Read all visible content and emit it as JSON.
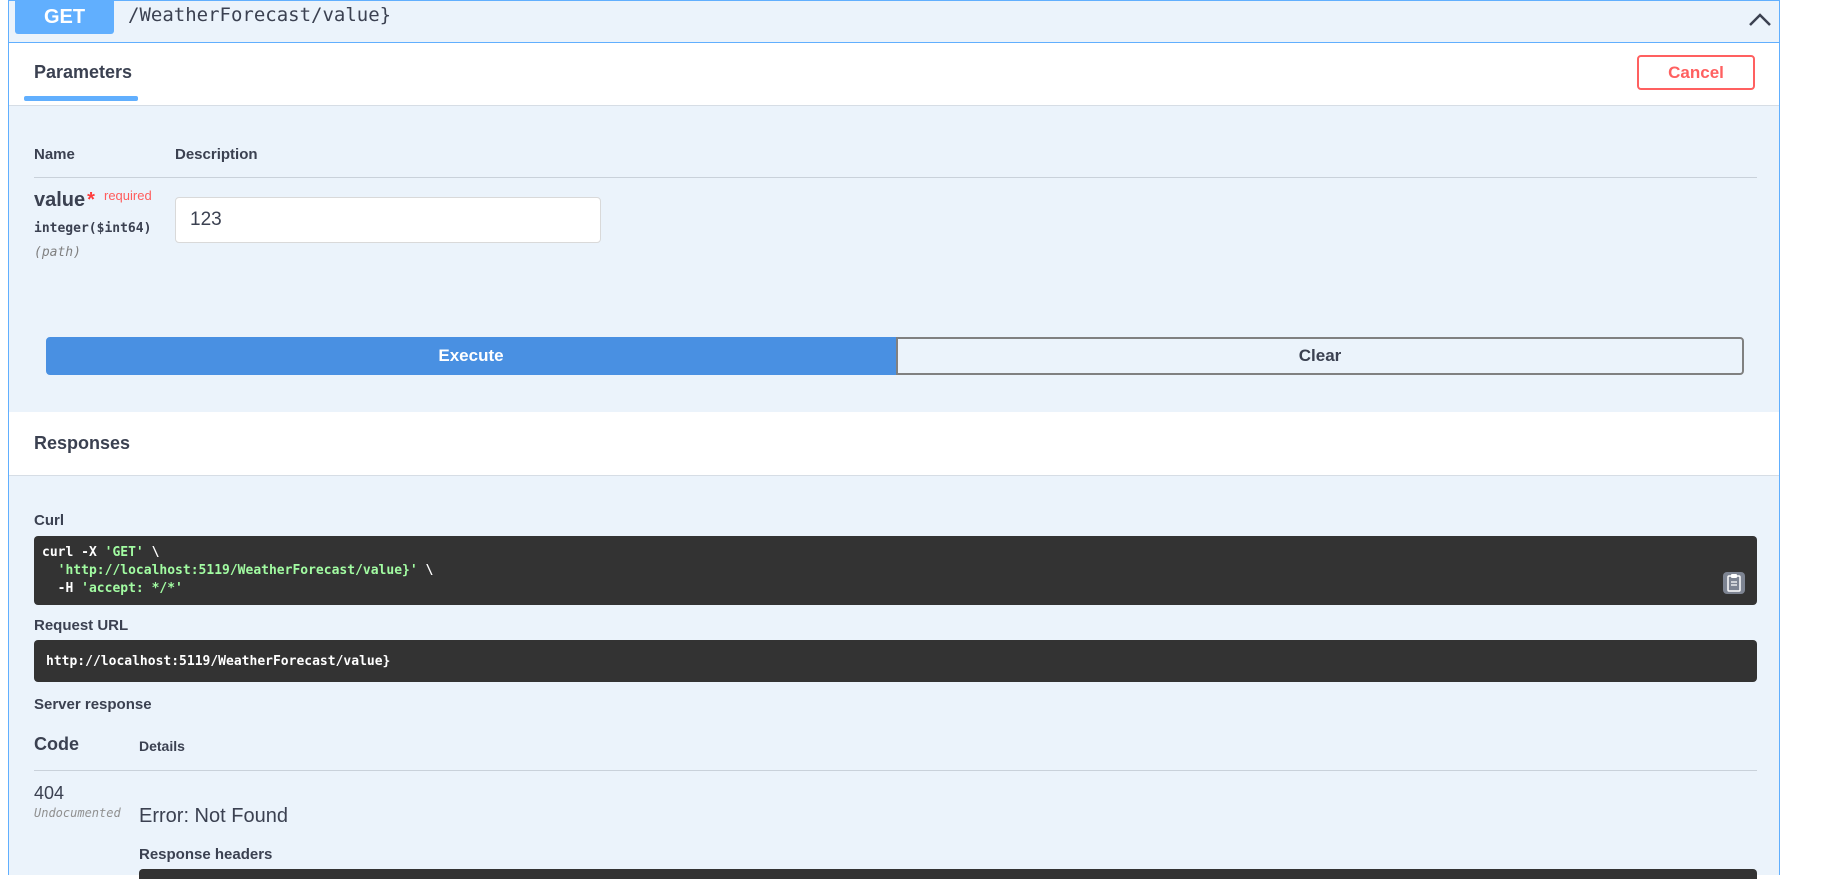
{
  "operation": {
    "method": "GET",
    "path": "/WeatherForecast/value}"
  },
  "tabs": {
    "parameters_label": "Parameters",
    "cancel_label": "Cancel"
  },
  "params_table": {
    "col_name": "Name",
    "col_description": "Description",
    "param": {
      "name": "value",
      "star": "*",
      "required": "required",
      "type": "integer($int64)",
      "in": "(path)",
      "value": "123"
    }
  },
  "actions": {
    "execute_label": "Execute",
    "clear_label": "Clear"
  },
  "responses": {
    "title": "Responses",
    "curl_label": "Curl",
    "curl": {
      "line1_cmd": "curl -X ",
      "line1_str": "'GET'",
      "line1_tail": " \\",
      "line2_str": "'http://localhost:5119/WeatherForecast/value}'",
      "line2_tail": " \\",
      "line3_cmd": "-H ",
      "line3_str": "'accept: */*'"
    },
    "request_url_label": "Request URL",
    "request_url": "http://localhost:5119/WeatherForecast/value}",
    "server_response_label": "Server response",
    "code_header": "Code",
    "details_header": "Details",
    "status_code": "404",
    "status_note": "Undocumented",
    "error_text": "Error: Not Found",
    "response_headers_label": "Response headers"
  },
  "colors": {
    "get_accent": "#61affe",
    "execute_bg": "#4990e2",
    "cancel_red": "#ff6060",
    "code_bg": "#333333"
  }
}
